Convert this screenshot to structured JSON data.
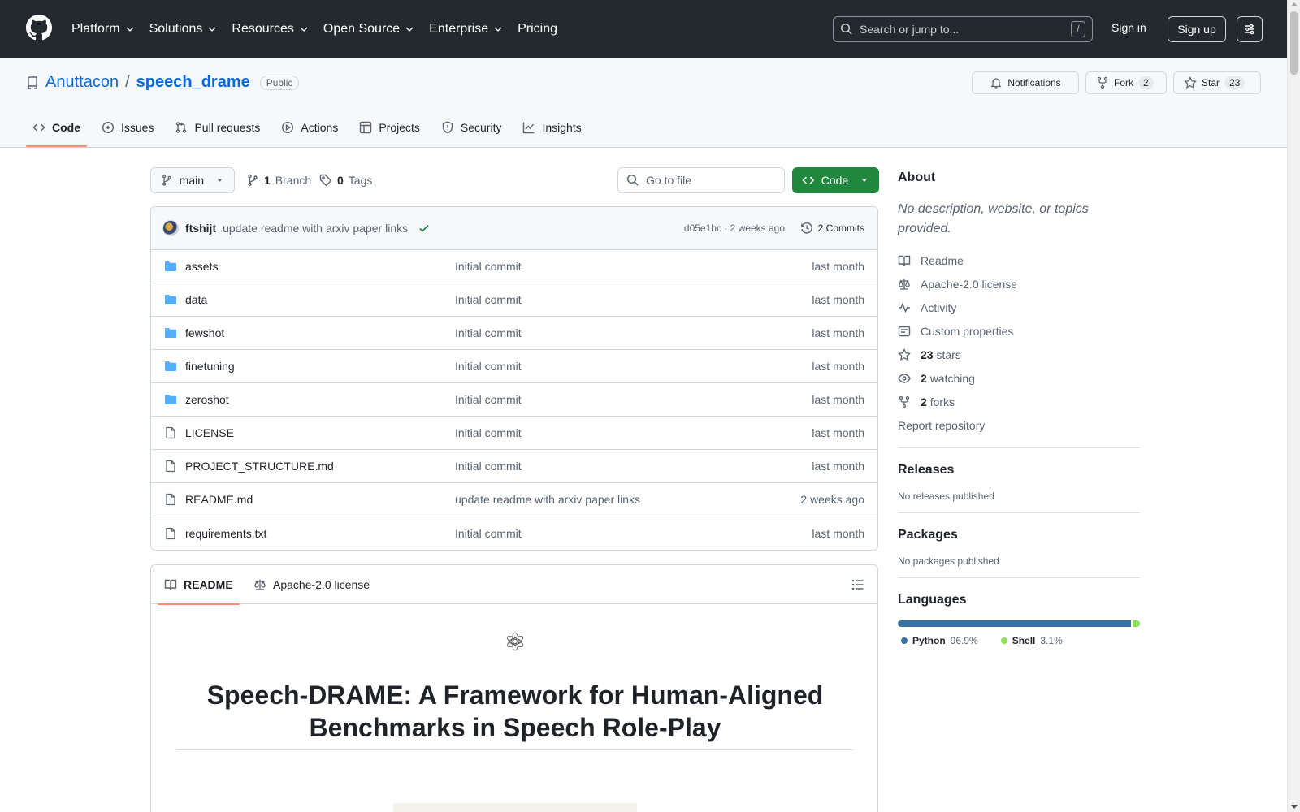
{
  "header": {
    "nav": [
      "Platform",
      "Solutions",
      "Resources",
      "Open Source",
      "Enterprise",
      "Pricing"
    ],
    "search_placeholder": "Search or jump to...",
    "search_key": "/",
    "sign_in": "Sign in",
    "sign_up": "Sign up"
  },
  "repo": {
    "owner": "Anuttacon",
    "separator": "/",
    "name": "speech_drame",
    "visibility": "Public",
    "notifications_label": "Notifications",
    "fork_label": "Fork",
    "fork_count": "2",
    "star_label": "Star",
    "star_count": "23",
    "tabs": [
      "Code",
      "Issues",
      "Pull requests",
      "Actions",
      "Projects",
      "Security",
      "Insights"
    ]
  },
  "toolbar": {
    "branch": "main",
    "branches_count": "1",
    "branches_label": "Branch",
    "tags_count": "0",
    "tags_label": "Tags",
    "goto_file_placeholder": "Go to file",
    "code_button": "Code"
  },
  "latest_commit": {
    "author": "ftshijt",
    "message": "update readme with arxiv paper links",
    "sha_and_time": "d05e1bc · 2 weeks ago",
    "commits_label": "2 Commits"
  },
  "files": [
    {
      "name": "assets",
      "type": "dir",
      "message": "Initial commit",
      "age": "last month"
    },
    {
      "name": "data",
      "type": "dir",
      "message": "Initial commit",
      "age": "last month"
    },
    {
      "name": "fewshot",
      "type": "dir",
      "message": "Initial commit",
      "age": "last month"
    },
    {
      "name": "finetuning",
      "type": "dir",
      "message": "Initial commit",
      "age": "last month"
    },
    {
      "name": "zeroshot",
      "type": "dir",
      "message": "Initial commit",
      "age": "last month"
    },
    {
      "name": "LICENSE",
      "type": "file",
      "message": "Initial commit",
      "age": "last month"
    },
    {
      "name": "PROJECT_STRUCTURE.md",
      "type": "file",
      "message": "Initial commit",
      "age": "last month"
    },
    {
      "name": "README.md",
      "type": "file",
      "message": "update readme with arxiv paper links",
      "age": "2 weeks ago"
    },
    {
      "name": "requirements.txt",
      "type": "file",
      "message": "Initial commit",
      "age": "last month"
    }
  ],
  "readme": {
    "tab_readme": "README",
    "tab_license": "Apache-2.0 license",
    "title_line1": "Speech-DRAME: A Framework for Human-Aligned",
    "title_line2": "Benchmarks in Speech Role-Play"
  },
  "about": {
    "heading": "About",
    "description": "No description, website, or topics provided.",
    "links": {
      "readme": "Readme",
      "license": "Apache-2.0 license",
      "activity": "Activity",
      "custom_properties": "Custom properties",
      "stars_count": "23",
      "stars_label": "stars",
      "watching_count": "2",
      "watching_label": "watching",
      "forks_count": "2",
      "forks_label": "forks",
      "report": "Report repository"
    }
  },
  "releases": {
    "heading": "Releases",
    "text": "No releases published"
  },
  "packages": {
    "heading": "Packages",
    "text": "No packages published"
  },
  "languages": {
    "heading": "Languages",
    "items": [
      {
        "name": "Python",
        "percent": "96.9%",
        "share": 96.9,
        "color": "#3572A5"
      },
      {
        "name": "Shell",
        "percent": "3.1%",
        "share": 3.1,
        "color": "#89e051"
      }
    ]
  }
}
